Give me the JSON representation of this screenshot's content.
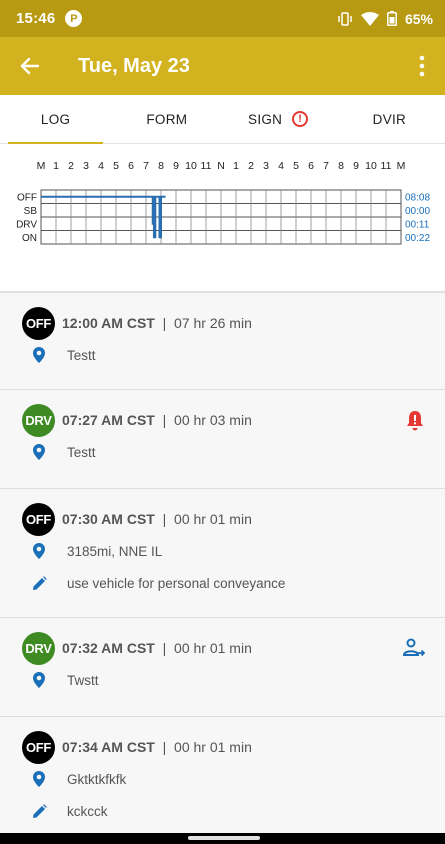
{
  "status_bar": {
    "time": "15:46",
    "app_icon": "P",
    "battery": "65%",
    "icons": [
      "vibrate-icon",
      "wifi-icon",
      "battery-icon"
    ]
  },
  "app_bar": {
    "title": "Tue, May 23"
  },
  "tabs": [
    {
      "label": "LOG",
      "active": true
    },
    {
      "label": "FORM",
      "active": false
    },
    {
      "label": "SIGN",
      "active": false,
      "warning": "!"
    },
    {
      "label": "DVIR",
      "active": false
    }
  ],
  "graph": {
    "hours": [
      "M",
      "1",
      "2",
      "3",
      "4",
      "5",
      "6",
      "7",
      "8",
      "9",
      "10",
      "11",
      "N",
      "1",
      "2",
      "3",
      "4",
      "5",
      "6",
      "7",
      "8",
      "9",
      "10",
      "11",
      "M"
    ],
    "rows": [
      {
        "status": "OFF",
        "total": "08:08"
      },
      {
        "status": "SB",
        "total": "00:00"
      },
      {
        "status": "DRV",
        "total": "00:11"
      },
      {
        "status": "ON",
        "total": "00:22"
      }
    ],
    "line_color": "#2a6fb0"
  },
  "events": [
    {
      "status": "OFF",
      "time": "12:00 AM CST",
      "duration": "07 hr  26 min",
      "location": "Testt",
      "alert": false
    },
    {
      "status": "DRV",
      "time": "07:27 AM CST",
      "duration": "00 hr  03 min",
      "location": "Testt",
      "alert": "bell-alert-icon"
    },
    {
      "status": "OFF",
      "time": "07:30 AM CST",
      "duration": "00 hr  01 min",
      "location": "3185mi, NNE IL",
      "note": "use vehicle for personal conveyance"
    },
    {
      "status": "DRV",
      "time": "07:32 AM CST",
      "duration": "00 hr  01 min",
      "location": "Twstt",
      "alert": "person-transfer-icon"
    },
    {
      "status": "OFF",
      "time": "07:34 AM CST",
      "duration": "00 hr  01 min",
      "location": "Gktktkfkfk",
      "note": "kckcck"
    }
  ],
  "colors": {
    "status_bar": "#b89a12",
    "app_bar": "#d2b21f",
    "drv": "#3d8b22",
    "off": "#000000",
    "icon_blue": "#1a6fb8",
    "alert_red": "#e53935"
  }
}
